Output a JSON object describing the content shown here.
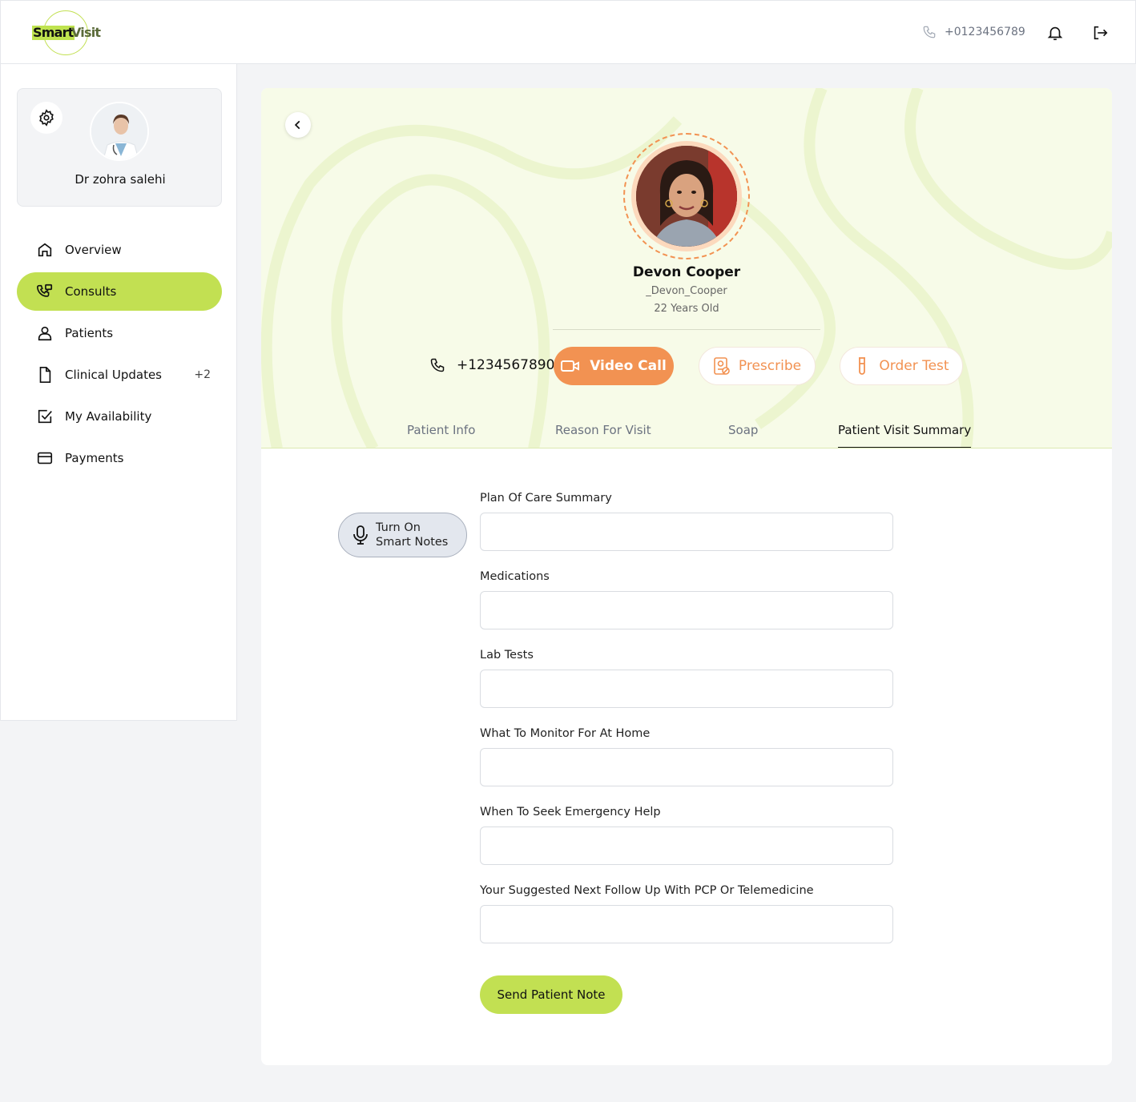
{
  "brand": {
    "smart": "Smart",
    "visit": "Visit"
  },
  "header": {
    "phone": "+0123456789"
  },
  "doctor": {
    "name": "Dr zohra salehi"
  },
  "nav": [
    {
      "label": "Overview",
      "icon": "home-icon",
      "active": false
    },
    {
      "label": "Consults",
      "icon": "consults-icon",
      "active": true
    },
    {
      "label": "Patients",
      "icon": "user-icon",
      "active": false
    },
    {
      "label": "Clinical Updates",
      "icon": "document-icon",
      "badge": "+2",
      "active": false
    },
    {
      "label": "My Availability",
      "icon": "check-square-icon",
      "active": false
    },
    {
      "label": "Payments",
      "icon": "card-icon",
      "active": false
    }
  ],
  "patient": {
    "name": "Devon Cooper",
    "username": "_Devon_Cooper",
    "age": "22 Years Old",
    "phone": "+1234567890"
  },
  "actions": {
    "video_call": "Video Call",
    "prescribe": "Prescribe",
    "order_test": "Order Test"
  },
  "tabs": [
    {
      "label": "Patient Info",
      "active": false
    },
    {
      "label": "Reason For Visit",
      "active": false
    },
    {
      "label": "Soap",
      "active": false
    },
    {
      "label": "Patient Visit Summary",
      "active": true
    }
  ],
  "smart_notes": {
    "line1": "Turn On",
    "line2": "Smart Notes"
  },
  "form": {
    "fields": [
      {
        "label": "Plan Of Care Summary",
        "value": ""
      },
      {
        "label": "Medications",
        "value": ""
      },
      {
        "label": "Lab Tests",
        "value": ""
      },
      {
        "label": "What To Monitor For At Home",
        "value": ""
      },
      {
        "label": "When To Seek Emergency Help",
        "value": ""
      },
      {
        "label": "Your Suggested Next Follow Up With PCP Or Telemedicine",
        "value": ""
      }
    ],
    "submit_label": "Send Patient Note"
  },
  "colors": {
    "accent": "#c2e052",
    "orange": "#f29252",
    "hero_bg": "#f7fbe8"
  }
}
